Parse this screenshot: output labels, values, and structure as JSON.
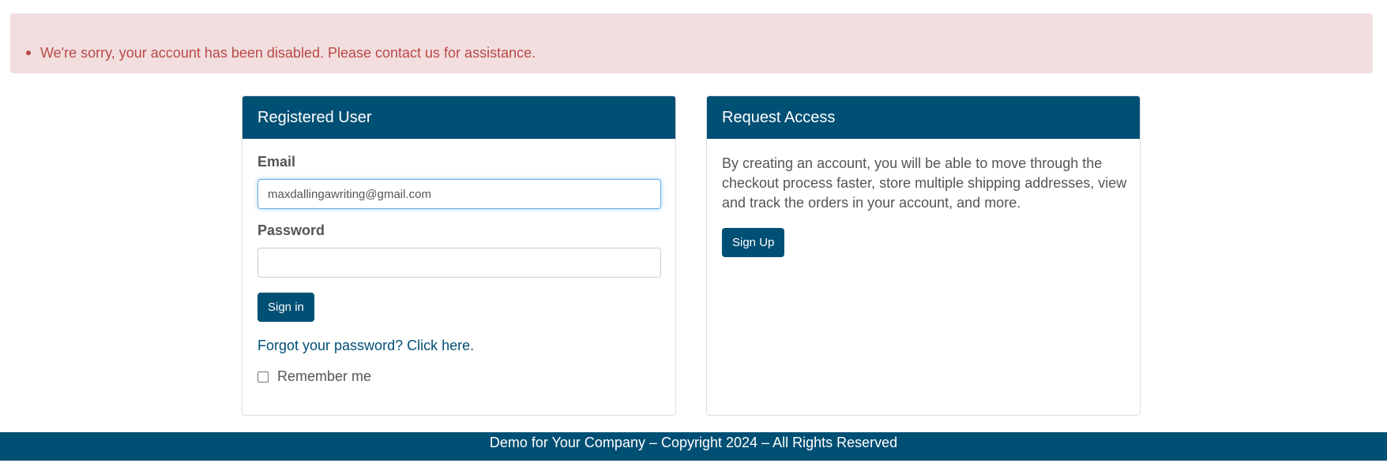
{
  "alert": {
    "message": "We're sorry, your account has been disabled. Please contact us for assistance."
  },
  "login_panel": {
    "title": "Registered User",
    "email_label": "Email",
    "email_value": "maxdallingawriting@gmail.com",
    "password_label": "Password",
    "password_value": "",
    "sign_in_label": "Sign in",
    "forgot_link": "Forgot your password? Click here.",
    "remember_label": "Remember me"
  },
  "request_panel": {
    "title": "Request Access",
    "description": "By creating an account, you will be able to move through the checkout process faster, store multiple shipping addresses, view and track the orders in your account, and more.",
    "sign_up_label": "Sign Up"
  },
  "footer": {
    "text": "Demo for Your Company – Copyright 2024 – All Rights Reserved"
  },
  "colors": {
    "brand": "#004f74",
    "alert_bg": "#f2dede",
    "alert_text": "#b94a48"
  }
}
